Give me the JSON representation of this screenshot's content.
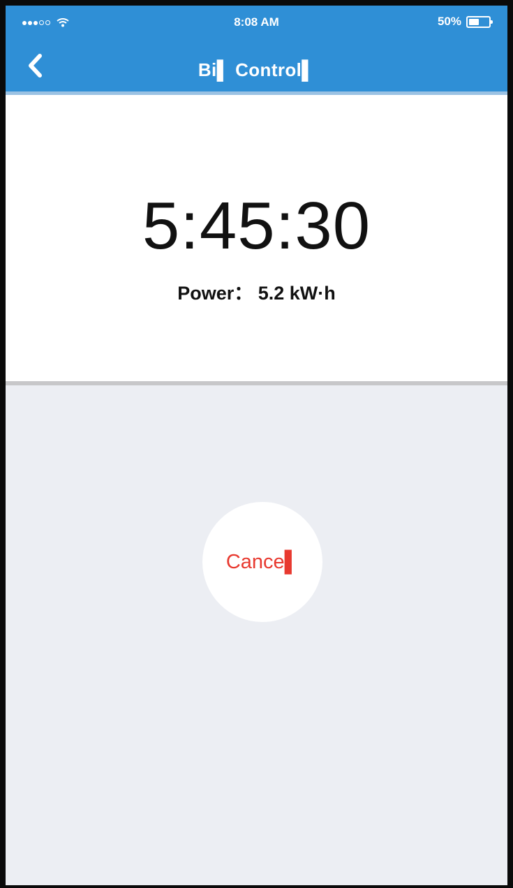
{
  "status_bar": {
    "time": "8:08 AM",
    "battery": "50%",
    "battery_level": 0.5,
    "signal_icon": "signal-dots-icon",
    "wifi_icon": "wifi-icon"
  },
  "nav": {
    "title": "Bi▌ Control▌",
    "back_icon": "chevron-left-icon"
  },
  "timer": {
    "remaining": "5:45:30",
    "power_label": "Power： 5.2 kW·h"
  },
  "actions": {
    "cancel_label": "Cance▌"
  },
  "colors": {
    "header": "#2f8fd6",
    "background": "#eceef3",
    "cancel_text": "#e8392f"
  }
}
